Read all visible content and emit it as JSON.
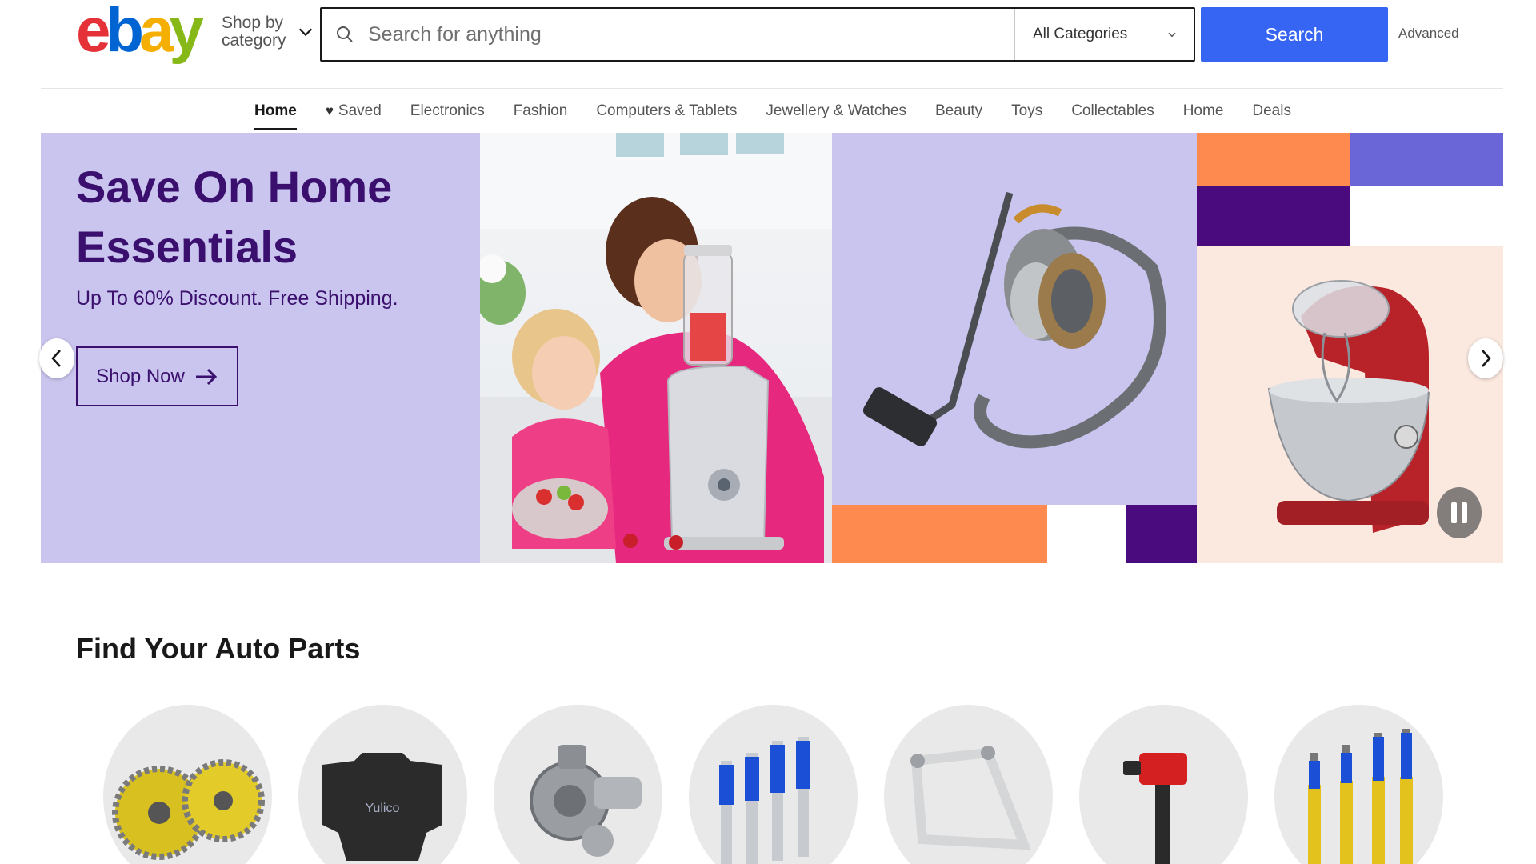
{
  "header": {
    "logo_text": "ebay",
    "shop_by_category": "Shop by category",
    "search_placeholder": "Search for anything",
    "category_select": "All Categories",
    "search_button": "Search",
    "advanced_link": "Advanced"
  },
  "nav": {
    "items": [
      {
        "label": "Home",
        "active": true
      },
      {
        "label": "Saved"
      },
      {
        "label": "Electronics"
      },
      {
        "label": "Fashion"
      },
      {
        "label": "Computers & Tablets"
      },
      {
        "label": "Jewellery & Watches"
      },
      {
        "label": "Beauty"
      },
      {
        "label": "Toys"
      },
      {
        "label": "Collectables"
      },
      {
        "label": "Home"
      },
      {
        "label": "Deals"
      }
    ]
  },
  "hero": {
    "title": "Save On Home Essentials",
    "subtitle": "Up To 60% Discount. Free Shipping.",
    "cta": "Shop Now",
    "colors": {
      "background": "#c9c5ee",
      "text": "#3b0f6e",
      "orange": "#ff8a50",
      "purple": "#4a0b7e",
      "blue": "#6b66d8"
    }
  },
  "auto_parts": {
    "title": "Find Your Auto Parts",
    "items": [
      {
        "icon": "cam-gears-icon"
      },
      {
        "icon": "engine-cover-icon",
        "label": "Yulico"
      },
      {
        "icon": "turbocharger-icon"
      },
      {
        "icon": "shock-absorbers-blue-icon"
      },
      {
        "icon": "control-arm-icon"
      },
      {
        "icon": "ignition-coil-icon"
      },
      {
        "icon": "shock-absorbers-yellow-icon"
      }
    ]
  },
  "colors": {
    "accent": "#3665f3",
    "text": "#191919"
  }
}
